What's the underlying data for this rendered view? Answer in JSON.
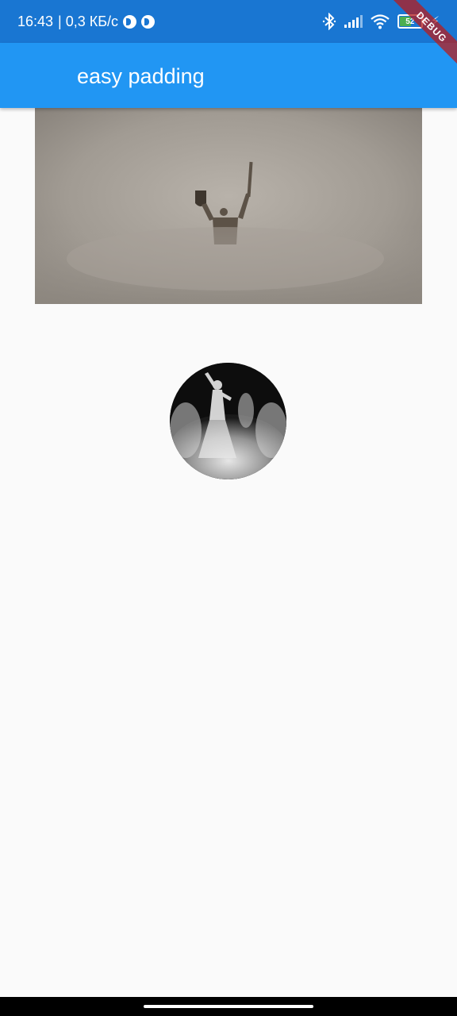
{
  "status_bar": {
    "time": "16:43",
    "speed": "| 0,3 КБ/с",
    "battery_level": "52",
    "background_color": "#1976d2",
    "icons": [
      "round-app-icon",
      "round-app-icon",
      "bluetooth-icon",
      "signal-icon",
      "wifi-icon",
      "battery-icon",
      "charging-icon"
    ]
  },
  "debug_banner": {
    "label": "DEBUG"
  },
  "app_bar": {
    "title": "easy padding",
    "background_color": "#2196f3"
  },
  "images": {
    "hero": {
      "subject": "foggy-monument-photo"
    },
    "avatar": {
      "subject": "dancer-photo"
    }
  }
}
